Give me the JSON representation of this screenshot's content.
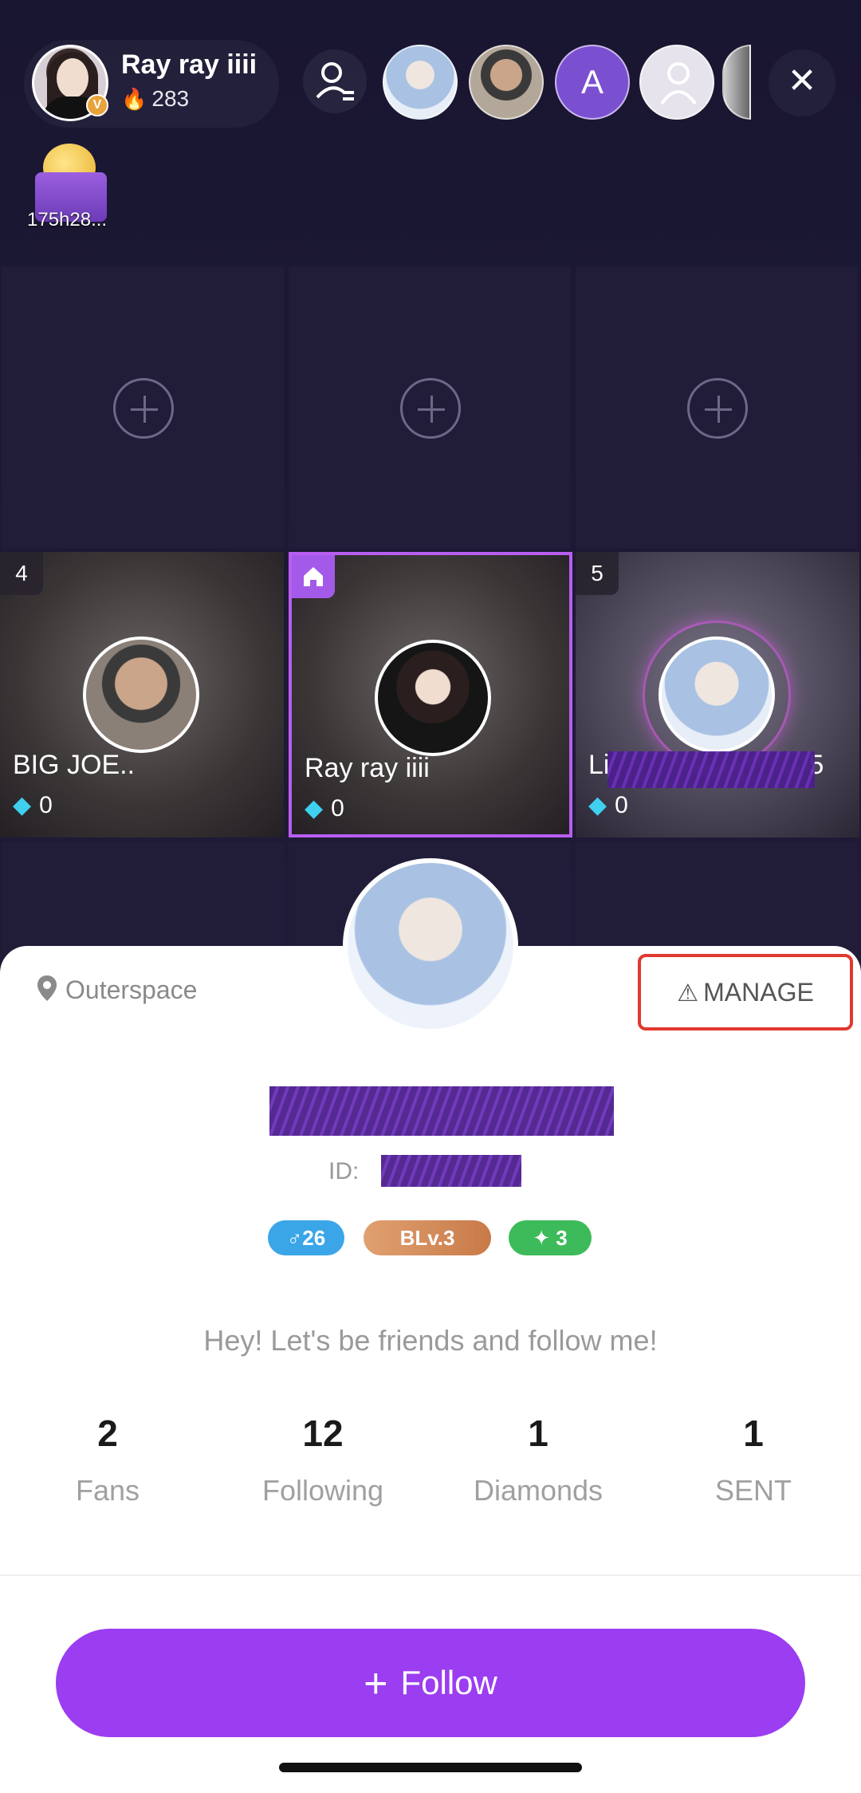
{
  "header": {
    "host_name": "Ray ray iiii",
    "host_heat": "283",
    "verified_mark": "V",
    "viewer_initial": "A",
    "close_label": "✕"
  },
  "gift": {
    "label": "175h28..."
  },
  "seats": [
    {
      "number": "4",
      "name": "BIG JOE..",
      "gems": "0"
    },
    {
      "number": "",
      "name": "Ray ray iiii",
      "gems": "0"
    },
    {
      "number": "5",
      "name": "Li",
      "name_tail": "5",
      "gems": "0"
    }
  ],
  "profile": {
    "location": "Outerspace",
    "manage_label": "MANAGE",
    "id_prefix": "ID:",
    "badges": {
      "gender": "♂26",
      "level": "BLv.3",
      "star": "✦ 3"
    },
    "bio": "Hey! Let's be friends and follow me!",
    "stats": [
      {
        "value": "2",
        "label": "Fans"
      },
      {
        "value": "12",
        "label": "Following"
      },
      {
        "value": "1",
        "label": "Diamonds"
      },
      {
        "value": "1",
        "label": "SENT"
      }
    ],
    "follow_label": "Follow"
  },
  "colors": {
    "accent": "#9b3df0",
    "manage_highlight": "#e0392f",
    "seat_border": "#b85ef0"
  }
}
